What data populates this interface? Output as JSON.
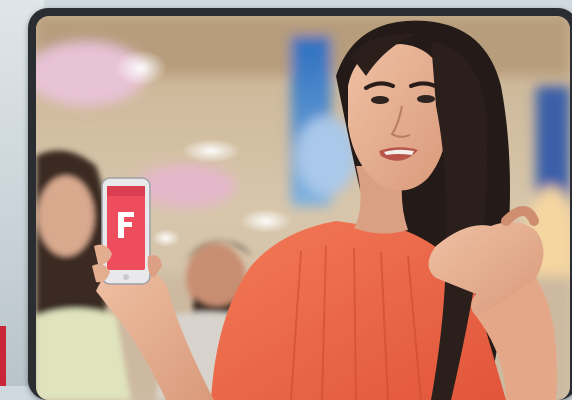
{
  "scene": {
    "app_label": "",
    "colors": {
      "frame": "#2a2d31",
      "phone_app": "#ee4d5e",
      "top": "#f06c4d",
      "hair": "#241a17",
      "skin": "#e3ad90",
      "bg_warm": "#d7c3a6"
    }
  }
}
